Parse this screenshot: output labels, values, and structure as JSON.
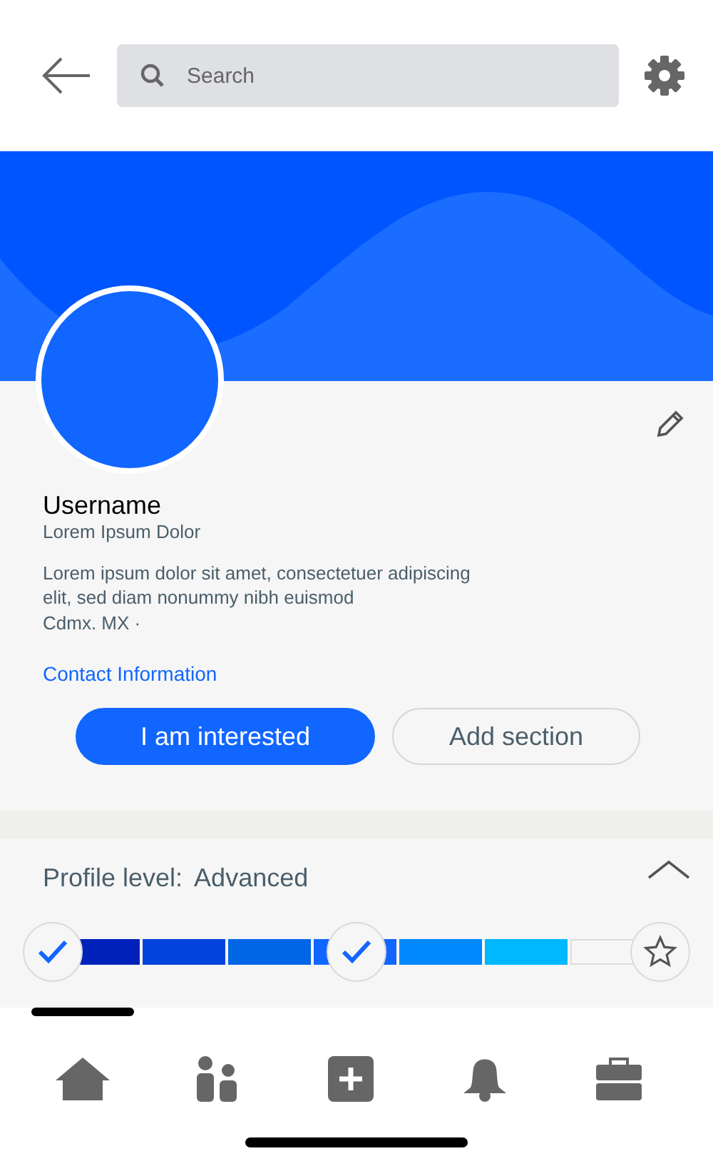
{
  "search": {
    "placeholder": "Search"
  },
  "profile": {
    "name": "Username",
    "headline": "Lorem Ipsum Dolor",
    "bio": "Lorem ipsum dolor sit amet, consectetuer adipiscing elit, sed diam nonummy nibh euismod",
    "location": "Cdmx. MX ·",
    "contact_link": "Contact Information"
  },
  "buttons": [
    {
      "label": "I am interested",
      "kind": "primary"
    },
    {
      "label": "Add section",
      "kind": "outline"
    }
  ],
  "level": {
    "label": "Profile level:",
    "value": "Advanced",
    "expanded": true,
    "milestones": [
      {
        "kind": "check",
        "checked": true
      },
      {
        "kind": "check",
        "checked": true
      },
      {
        "kind": "star",
        "checked": false
      }
    ],
    "segments": [
      {
        "filled": true,
        "color": "#0022bb"
      },
      {
        "filled": true,
        "color": "#0044dd"
      },
      {
        "filled": true,
        "color": "#0066e6"
      },
      {
        "filled": true,
        "color": "#1166ff"
      },
      {
        "filled": true,
        "color": "#0088ff"
      },
      {
        "filled": true,
        "color": "#00b8ff"
      },
      {
        "filled": false
      }
    ]
  },
  "nav": [
    {
      "kind": "home",
      "selected": true
    },
    {
      "kind": "people",
      "selected": false
    },
    {
      "kind": "add",
      "selected": false
    },
    {
      "kind": "bell",
      "selected": false
    },
    {
      "kind": "briefcase",
      "selected": false
    }
  ]
}
